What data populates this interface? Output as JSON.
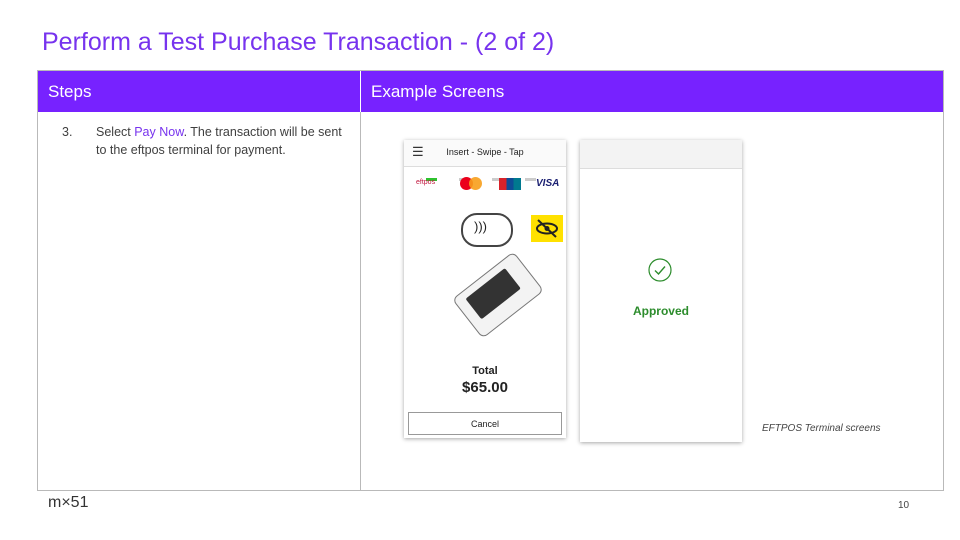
{
  "title": "Perform a Test Purchase Transaction - (2 of 2)",
  "table": {
    "headers": [
      "Steps",
      "Example Screens"
    ],
    "step": {
      "number": "3.",
      "prefix": "Select ",
      "highlight": "Pay Now",
      "suffix": ". The transaction will be sent to the eftpos terminal for payment."
    }
  },
  "screen1": {
    "menu_icon": "hamburger-icon",
    "bar_title": "Insert - Swipe - Tap",
    "logos": [
      "eftpos",
      "mastercard",
      "unionpay",
      "VISA"
    ],
    "eftpos_label": "eftpos",
    "visa_label": "VISA",
    "total_label": "Total",
    "total_amount": "$65.00",
    "cancel_label": "Cancel"
  },
  "screen2": {
    "status_icon": "check-circle-icon",
    "status_label": "Approved"
  },
  "caption": "EFTPOS Terminal screens",
  "footer": {
    "brand": "m×51",
    "page": "10"
  },
  "colors": {
    "accent": "#7733ee",
    "header_bg": "#7722ff",
    "approved": "#2c8c2c"
  }
}
